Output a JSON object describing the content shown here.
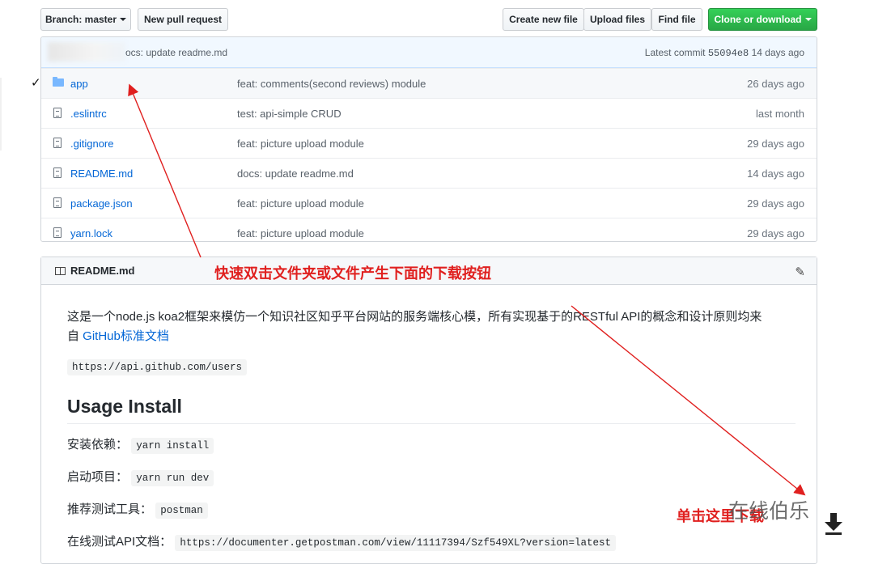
{
  "toolbar": {
    "branch_label": "Branch: master",
    "new_pr": "New pull request",
    "create_file": "Create new file",
    "upload_files": "Upload files",
    "find_file": "Find file",
    "clone": "Clone or download"
  },
  "commit": {
    "message": "ocs: update readme.md",
    "latest_prefix": "Latest commit",
    "sha": "55094e8",
    "age": "14 days ago"
  },
  "files": [
    {
      "name": "app",
      "type": "folder",
      "message": "feat: comments(second reviews) module",
      "age": "26 days ago"
    },
    {
      "name": ".eslintrc",
      "type": "file",
      "message": "test: api-simple CRUD",
      "age": "last month"
    },
    {
      "name": ".gitignore",
      "type": "file",
      "message": "feat: picture upload module",
      "age": "29 days ago"
    },
    {
      "name": "README.md",
      "type": "file",
      "message": "docs: update readme.md",
      "age": "14 days ago"
    },
    {
      "name": "package.json",
      "type": "file",
      "message": "feat: picture upload module",
      "age": "29 days ago"
    },
    {
      "name": "yarn.lock",
      "type": "file",
      "message": "feat: picture upload module",
      "age": "29 days ago"
    }
  ],
  "readme": {
    "title": "README.md",
    "annotation": "快速双击文件夹或文件产生下面的下载按钮",
    "intro_line1": "这是一个node.js koa2框架来模仿一个知识社区知乎平台网站的服务端核心模，所有实现基于的RESTful API的概念和设计原则均来",
    "intro_prefix": "自 ",
    "intro_link": "GitHub标准文档",
    "api_url": "https://api.github.com/users",
    "heading": "Usage Install",
    "install_label": "安装依赖：",
    "install_cmd": "yarn install",
    "start_label": "启动项目：",
    "start_cmd": "yarn run dev",
    "tool_label": "推荐测试工具：",
    "tool_value": "postman",
    "doc_label": "在线测试API文档：",
    "doc_url": "https://documenter.getpostman.com/view/11117394/Szf549XL?version=latest"
  },
  "annotations": {
    "click_here": "单击这里下载",
    "watermark": "在线伯乐"
  },
  "colors": {
    "link": "#0366d6",
    "annotation_red": "#e0201f",
    "green_button": "#28a745"
  },
  "icons": {
    "folder": "folder-icon",
    "file": "file-icon",
    "book": "book-icon",
    "pencil": "pencil-icon",
    "download": "download-arrow-icon"
  }
}
